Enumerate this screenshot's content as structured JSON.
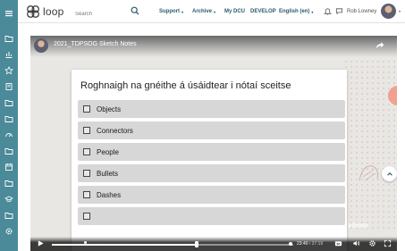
{
  "header": {
    "logo_text": "loop",
    "search_placeholder": "Search",
    "nav": [
      {
        "label": "Support",
        "has_menu": true
      },
      {
        "label": "Archive",
        "has_menu": true
      },
      {
        "label": "My DCU",
        "has_menu": false
      },
      {
        "label": "DEVELOP",
        "has_menu": false
      },
      {
        "label": "English (en)",
        "has_menu": true
      }
    ],
    "user_name": "Rob Lowney",
    "menu_caret": "▾"
  },
  "sidebar": {
    "icons": [
      "menu-icon",
      "folder-icon",
      "grades-icon",
      "star-icon",
      "book-icon",
      "folder-icon",
      "folder-icon",
      "dashboard-icon",
      "folder-icon",
      "calendar-icon",
      "folder-icon",
      "graduation-cap-icon",
      "folder-icon",
      "settings-icon"
    ]
  },
  "video": {
    "title": "2021_TDPSOG Sketch Notes",
    "watermark": "vimeo",
    "player": {
      "current_time": "23:40",
      "total_time": "/ 37:19",
      "progress": 0.634
    }
  },
  "quiz": {
    "question": "Roghnaigh na gnéithe á úsáidtear i nótaí sceitse",
    "options": [
      {
        "label": "Objects",
        "checked": false
      },
      {
        "label": "Connectors",
        "checked": false
      },
      {
        "label": "People",
        "checked": false
      },
      {
        "label": "Bullets",
        "checked": false
      },
      {
        "label": "Dashes",
        "checked": false
      },
      {
        "label": "",
        "checked": false
      }
    ]
  },
  "colors": {
    "sidebar": "#4a8a99",
    "nav_text": "#2b5a6b",
    "option_bg": "#d7d7d7",
    "accent_dot": "#f2a08f"
  }
}
